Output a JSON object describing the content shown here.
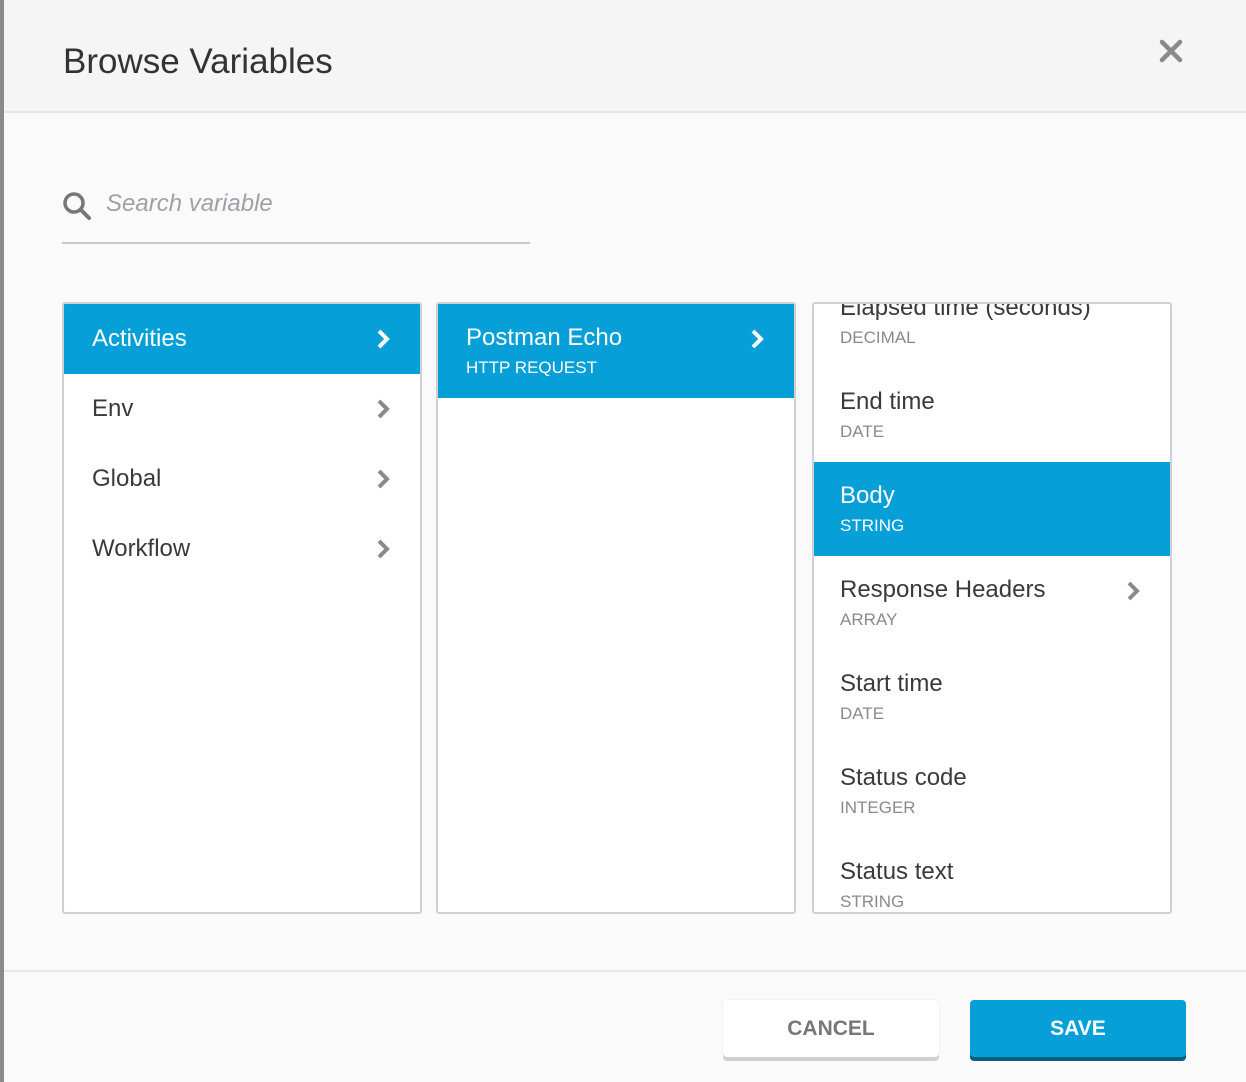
{
  "dialog": {
    "title": "Browse Variables",
    "close_icon": "close-icon"
  },
  "search": {
    "placeholder": "Search variable",
    "value": ""
  },
  "columns": {
    "scopes": [
      {
        "label": "Activities",
        "selected": true
      },
      {
        "label": "Env"
      },
      {
        "label": "Global"
      },
      {
        "label": "Workflow"
      }
    ],
    "activities": [
      {
        "name": "Postman Echo",
        "type": "HTTP REQUEST",
        "selected": true
      }
    ],
    "variables": [
      {
        "name": "Elapsed time (seconds)",
        "type": "DECIMAL"
      },
      {
        "name": "End time",
        "type": "DATE"
      },
      {
        "name": "Body",
        "type": "STRING",
        "selected": true
      },
      {
        "name": "Response Headers",
        "type": "ARRAY",
        "expandable": true
      },
      {
        "name": "Start time",
        "type": "DATE"
      },
      {
        "name": "Status code",
        "type": "INTEGER"
      },
      {
        "name": "Status text",
        "type": "STRING"
      }
    ]
  },
  "footer": {
    "cancel_label": "CANCEL",
    "save_label": "SAVE"
  },
  "colors": {
    "accent": "#069fd8",
    "text": "#333333",
    "muted": "#8a8a8e"
  }
}
